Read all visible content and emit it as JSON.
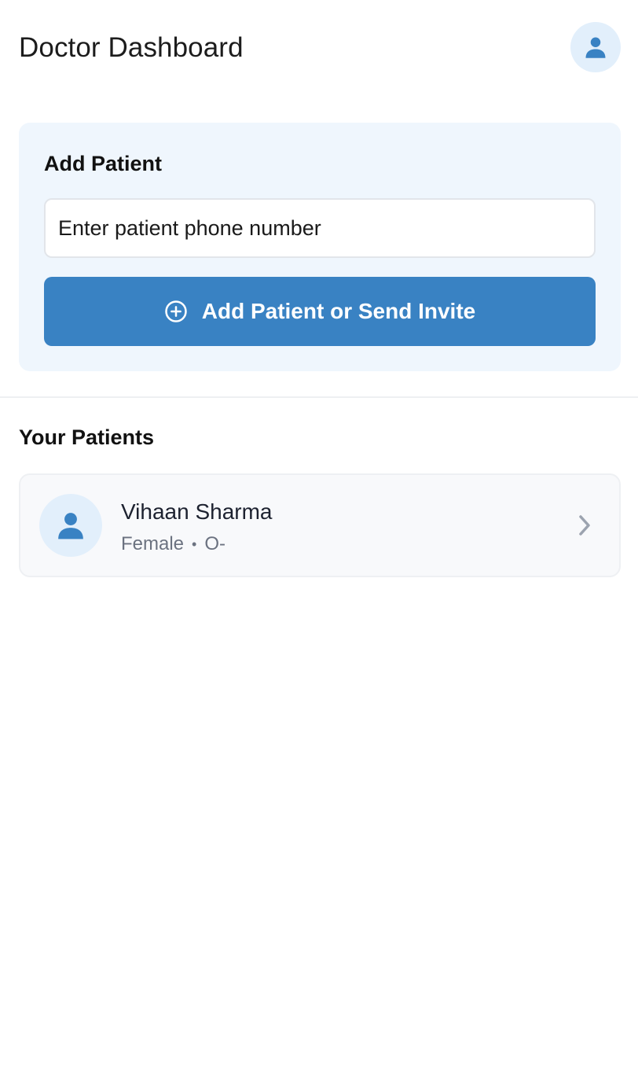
{
  "header": {
    "title": "Doctor Dashboard",
    "profile_icon": "user-icon"
  },
  "add_patient": {
    "title": "Add Patient",
    "phone_placeholder": "Enter patient phone number",
    "button_label": "Add Patient or Send Invite",
    "button_icon": "plus-circle-icon"
  },
  "patients": {
    "title": "Your Patients",
    "items": [
      {
        "name": "Vihaan Sharma",
        "gender": "Female",
        "separator": "•",
        "blood_group": "O-"
      }
    ]
  },
  "colors": {
    "accent": "#3982c3",
    "card_bg": "#eff6fd",
    "avatar_bg": "#e2effb"
  }
}
